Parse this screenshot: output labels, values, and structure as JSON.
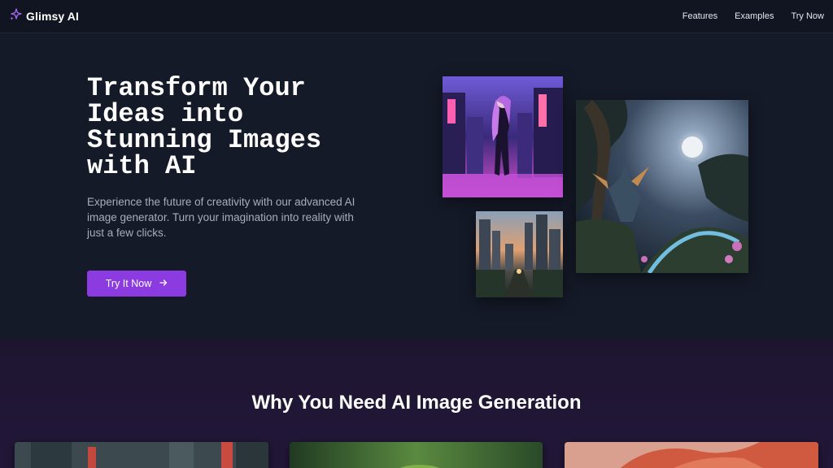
{
  "nav": {
    "brand": "Glimsy AI",
    "brand_icon": "sparkle-icon",
    "links": [
      "Features",
      "Examples",
      "Try Now"
    ]
  },
  "hero": {
    "title": "Transform Your Ideas into Stunning Images with AI",
    "description": "Experience the future of creativity with our advanced AI image generator. Turn your imagination into reality with just a few clicks.",
    "cta_label": "Try It Now",
    "cta_icon": "arrow-right-icon",
    "images": [
      "anime-city-girl-image",
      "city-sunset-image",
      "fantasy-dragon-forest-image"
    ]
  },
  "section2": {
    "title": "Why You Need AI Image Generation",
    "thumbnails": [
      "neon-street-thumbnail",
      "green-blur-thumbnail",
      "red-feathers-thumbnail"
    ]
  },
  "colors": {
    "accent": "#8b3be0",
    "background": "#151a28",
    "nav_background": "#111522",
    "section_background": "#1d1530"
  }
}
